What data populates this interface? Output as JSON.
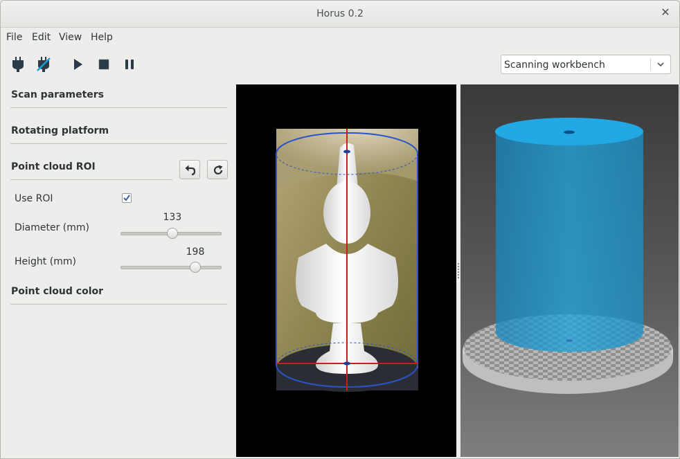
{
  "window": {
    "title": "Horus 0.2"
  },
  "menu": [
    "File",
    "Edit",
    "View",
    "Help"
  ],
  "toolbar": {
    "buttons": [
      "connect-icon",
      "disconnect-icon",
      "play-icon",
      "stop-icon",
      "pause-icon"
    ],
    "workbench": {
      "selected": "Scanning workbench"
    }
  },
  "sidebar": {
    "scan_parameters": "Scan parameters",
    "rotating_platform": "Rotating platform",
    "point_cloud_roi": {
      "title": "Point cloud ROI",
      "use_roi_label": "Use ROI",
      "use_roi_checked": true,
      "diameter_label": "Diameter (mm)",
      "diameter_value": "133",
      "diameter_fraction": 0.52,
      "height_label": "Height (mm)",
      "height_value": "198",
      "height_fraction": 0.75
    },
    "point_cloud_color": "Point cloud color"
  },
  "colors": {
    "roi_cylinder": "#1a9fd6",
    "overlay_blue": "#2a53c9",
    "overlay_red": "#d21a1a",
    "checkbox_accent": "#3465a4"
  }
}
